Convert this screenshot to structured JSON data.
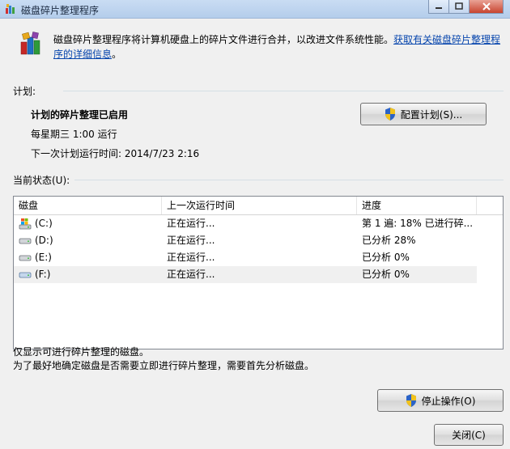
{
  "window": {
    "title": "磁盘碎片整理程序"
  },
  "header": {
    "description": "磁盘碎片整理程序将计算机硬盘上的碎片文件进行合并，以改进文件系统性能。",
    "link": "获取有关磁盘碎片整理程序的详细信息",
    "link_tail": "。"
  },
  "schedule": {
    "group_label": "计划:",
    "status": "计划的碎片整理已启用",
    "frequency": "每星期三  1:00 运行",
    "next_run": "下一次计划运行时间: 2014/7/23 2:16",
    "configure_button": "配置计划(S)..."
  },
  "current_status": {
    "group_label": "当前状态(U):",
    "columns": [
      "磁盘",
      "上一次运行时间",
      "进度"
    ],
    "rows": [
      {
        "disk": "(C:)",
        "last_run": "正在运行...",
        "progress": "第 1 遍: 18% 已进行碎...",
        "icon": "system-drive-icon"
      },
      {
        "disk": "(D:)",
        "last_run": "正在运行...",
        "progress": "已分析 28%",
        "icon": "hard-drive-icon"
      },
      {
        "disk": "(E:)",
        "last_run": "正在运行...",
        "progress": "已分析 0%",
        "icon": "hard-drive-icon"
      },
      {
        "disk": "(F:)",
        "last_run": "正在运行...",
        "progress": "已分析 0%",
        "icon": "hard-drive-icon"
      }
    ]
  },
  "notes": {
    "line1": "仅显示可进行碎片整理的磁盘。",
    "line2": "为了最好地确定磁盘是否需要立即进行碎片整理，需要首先分析磁盘。"
  },
  "buttons": {
    "stop": "停止操作(O)",
    "close": "关闭(C)"
  },
  "colors": {
    "link": "#0645ad",
    "selected_row": "#f0f0f0",
    "window_bg": "#f0f0f0"
  }
}
